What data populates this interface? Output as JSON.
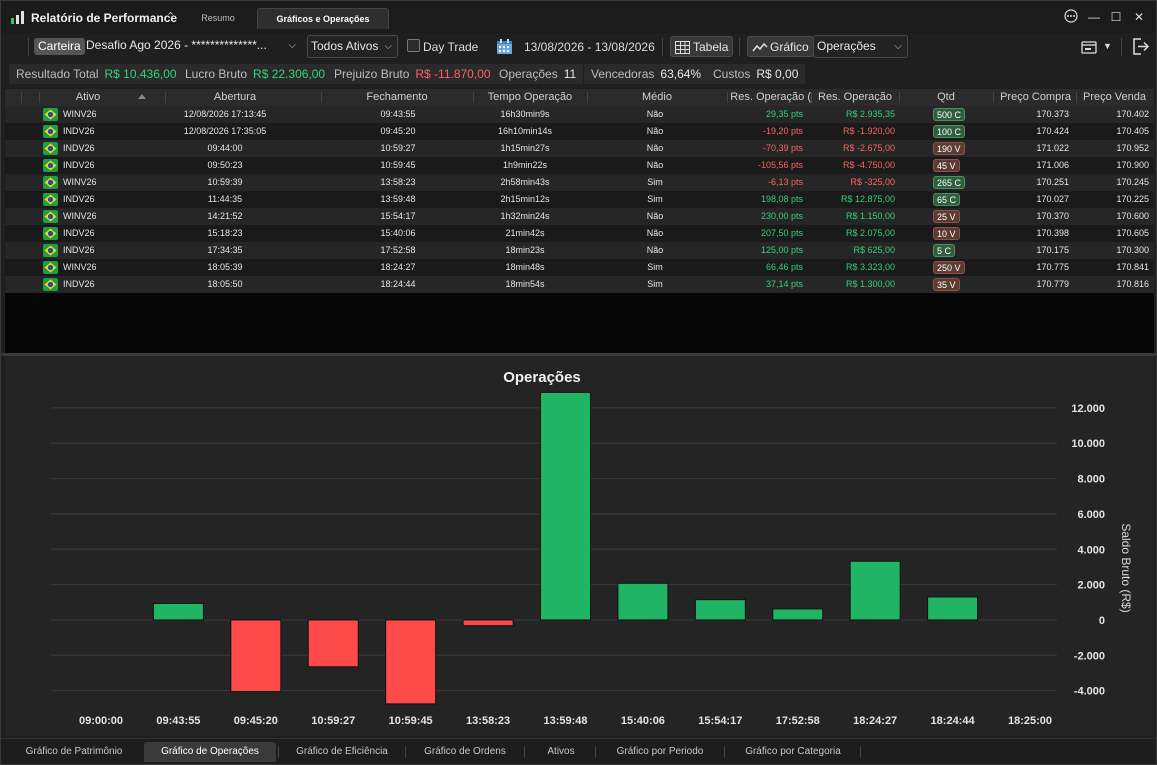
{
  "window": {
    "title": "Relatório de Performance",
    "tabs": [
      {
        "label": "Resumo",
        "active": false
      },
      {
        "label": "Gráficos e Operações",
        "active": true
      }
    ]
  },
  "toolbar": {
    "carteira_label": "Carteira",
    "portfolio_value": "Desafio Ago 2026 - **************...",
    "asset_filter": "Todos Ativos",
    "day_trade_label": "Day Trade",
    "day_trade_checked": false,
    "date_range": "13/08/2026 - 13/08/2026",
    "table_button": "Tabela",
    "chart_button": "Gráfico",
    "chart_type": "Operações"
  },
  "stats": [
    {
      "label": "Resultado Total",
      "value": "R$ 10.436,00",
      "tone": "pos"
    },
    {
      "label": "Lucro Bruto",
      "value": "R$ 22.306,00",
      "tone": "pos"
    },
    {
      "label": "Prejuizo Bruto",
      "value": "R$ -11.870,00",
      "tone": "neg"
    },
    {
      "label": "Operações",
      "value": "11",
      "tone": "neutral"
    },
    {
      "label": "Vencedoras",
      "value": "63,64%",
      "tone": "neutral"
    },
    {
      "label": "Custos",
      "value": "R$ 0,00",
      "tone": "neutral"
    }
  ],
  "table": {
    "columns": [
      "Ativo",
      "Abertura",
      "Fechamento",
      "Tempo Operação",
      "Médio",
      "Res. Operação (",
      "Res. Operação",
      "Qtd",
      "Preço Compra",
      "Preço Venda"
    ],
    "rows": [
      {
        "ativo": "WINV26",
        "abertura": "12/08/2026 17:13:45",
        "fechamento": "09:43:55",
        "tempo": "16h30min9s",
        "medio": "Não",
        "res_pts": "29,35 pts",
        "res_brl": "R$ 2.935,35",
        "qtd": "500 C",
        "side": "buy",
        "compra": "170.373",
        "venda": "170.402",
        "tone": "pos"
      },
      {
        "ativo": "INDV26",
        "abertura": "12/08/2026 17:35:05",
        "fechamento": "09:45:20",
        "tempo": "16h10min14s",
        "medio": "Não",
        "res_pts": "-19,20 pts",
        "res_brl": "R$ -1.920,00",
        "qtd": "100 C",
        "side": "buy",
        "compra": "170.424",
        "venda": "170.405",
        "tone": "neg"
      },
      {
        "ativo": "INDV26",
        "abertura": "09:44:00",
        "fechamento": "10:59:27",
        "tempo": "1h15min27s",
        "medio": "Não",
        "res_pts": "-70,39 pts",
        "res_brl": "R$ -2.675,00",
        "qtd": "190 V",
        "side": "sell",
        "compra": "171.022",
        "venda": "170.952",
        "tone": "neg"
      },
      {
        "ativo": "INDV26",
        "abertura": "09:50:23",
        "fechamento": "10:59:45",
        "tempo": "1h9min22s",
        "medio": "Não",
        "res_pts": "-105,56 pts",
        "res_brl": "R$ -4.750,00",
        "qtd": "45 V",
        "side": "sell",
        "compra": "171.006",
        "venda": "170.900",
        "tone": "neg"
      },
      {
        "ativo": "WINV26",
        "abertura": "10:59:39",
        "fechamento": "13:58:23",
        "tempo": "2h58min43s",
        "medio": "Sim",
        "res_pts": "-6,13 pts",
        "res_brl": "R$ -325,00",
        "qtd": "265 C",
        "side": "buy",
        "compra": "170.251",
        "venda": "170.245",
        "tone": "neg"
      },
      {
        "ativo": "INDV26",
        "abertura": "11:44:35",
        "fechamento": "13:59:48",
        "tempo": "2h15min12s",
        "medio": "Sim",
        "res_pts": "198,08 pts",
        "res_brl": "R$ 12.875,00",
        "qtd": "65 C",
        "side": "buy",
        "compra": "170.027",
        "venda": "170.225",
        "tone": "pos"
      },
      {
        "ativo": "WINV26",
        "abertura": "14:21:52",
        "fechamento": "15:54:17",
        "tempo": "1h32min24s",
        "medio": "Não",
        "res_pts": "230,00 pts",
        "res_brl": "R$ 1.150,00",
        "qtd": "25 V",
        "side": "sell",
        "compra": "170.370",
        "venda": "170.600",
        "tone": "pos"
      },
      {
        "ativo": "INDV26",
        "abertura": "15:18:23",
        "fechamento": "15:40:06",
        "tempo": "21min42s",
        "medio": "Não",
        "res_pts": "207,50 pts",
        "res_brl": "R$ 2.075,00",
        "qtd": "10 V",
        "side": "sell",
        "compra": "170.398",
        "venda": "170.605",
        "tone": "pos"
      },
      {
        "ativo": "INDV26",
        "abertura": "17:34:35",
        "fechamento": "17:52:58",
        "tempo": "18min23s",
        "medio": "Não",
        "res_pts": "125,00 pts",
        "res_brl": "R$ 625,00",
        "qtd": "5 C",
        "side": "buy",
        "compra": "170.175",
        "venda": "170.300",
        "tone": "pos"
      },
      {
        "ativo": "WINV26",
        "abertura": "18:05:39",
        "fechamento": "18:24:27",
        "tempo": "18min48s",
        "medio": "Sim",
        "res_pts": "66,46 pts",
        "res_brl": "R$ 3.323,00",
        "qtd": "250 V",
        "side": "sell",
        "compra": "170.775",
        "venda": "170.841",
        "tone": "pos"
      },
      {
        "ativo": "INDV26",
        "abertura": "18:05:50",
        "fechamento": "18:24:44",
        "tempo": "18min54s",
        "medio": "Sim",
        "res_pts": "37,14 pts",
        "res_brl": "R$ 1.300,00",
        "qtd": "35 V",
        "side": "sell",
        "compra": "170.779",
        "venda": "170.816",
        "tone": "pos"
      }
    ]
  },
  "chart_data": {
    "type": "bar",
    "title": "Operações",
    "ylabel": "Saldo Bruto (R$)",
    "xlabel": "",
    "categories": [
      "09:00:00",
      "09:43:55",
      "09:45:20",
      "10:59:27",
      "10:59:45",
      "13:58:23",
      "13:59:48",
      "15:40:06",
      "15:54:17",
      "17:52:58",
      "18:24:27",
      "18:24:44",
      "18:25:00"
    ],
    "values": [
      null,
      935,
      -4050,
      -2650,
      -4750,
      -325,
      12875,
      2075,
      1150,
      625,
      3323,
      1300,
      null
    ],
    "ylim": [
      -4700,
      12900
    ],
    "yticks": [
      -4000,
      -2000,
      0,
      2000,
      4000,
      6000,
      8000,
      10000,
      12000
    ],
    "ytick_labels": [
      "-4.000",
      "-2.000",
      "0",
      "2.000",
      "4.000",
      "6.000",
      "8.000",
      "10.000",
      "12.000"
    ],
    "grid": true,
    "colors": {
      "positive": "#1fb564",
      "negative": "#ff4a4a"
    }
  },
  "bottom_tabs": [
    {
      "label": "Gráfico de Patrimônio",
      "active": false
    },
    {
      "label": "Gráfico de Operações",
      "active": true
    },
    {
      "label": "Gráfico de Eficiência",
      "active": false
    },
    {
      "label": "Gráfico de Ordens",
      "active": false
    },
    {
      "label": "Ativos",
      "active": false
    },
    {
      "label": "Gráfico por Periodo",
      "active": false
    },
    {
      "label": "Gráfico por Categoria",
      "active": false
    }
  ],
  "colors": {
    "accent_green": "#35d07f",
    "accent_red": "#ff6262",
    "background": "#1f1f1f"
  },
  "icons": [
    "app-logo-icon",
    "chevron-up-icon",
    "more-icon",
    "minimize-icon",
    "maximize-icon",
    "close-icon",
    "calendar-icon",
    "table-icon",
    "line-chart-icon",
    "export-icon",
    "logout-icon",
    "brazil-flag-icon"
  ]
}
